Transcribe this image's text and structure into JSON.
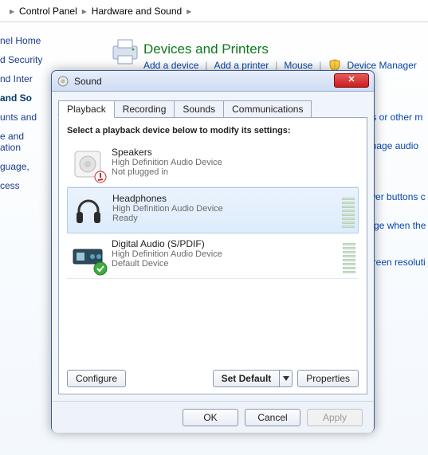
{
  "breadcrumb": {
    "a": "Control Panel",
    "b": "Hardware and Sound"
  },
  "leftnav": {
    "home": "nel Home",
    "i1": "d Security",
    "i2": "nd Inter",
    "i3": "and So",
    "i4": "unts and",
    "i5": "e and\nation",
    "i6": "guage,",
    "i7": "cess"
  },
  "header": {
    "title": "Devices and Printers",
    "links": {
      "add_device": "Add a device",
      "add_printer": "Add a printer",
      "mouse": "Mouse",
      "devmgr": "Device Manager"
    }
  },
  "sidelinks": {
    "a": "CDs or other m",
    "b": "Manage audio",
    "c": "power buttons c",
    "d": "hange when the",
    "e": "t screen resoluti"
  },
  "dialog": {
    "title": "Sound",
    "tabs": {
      "playback": "Playback",
      "recording": "Recording",
      "sounds": "Sounds",
      "comm": "Communications"
    },
    "instruction": "Select a playback device below to modify its settings:",
    "devices": [
      {
        "name": "Speakers",
        "desc": "High Definition Audio Device",
        "status": "Not plugged in"
      },
      {
        "name": "Headphones",
        "desc": "High Definition Audio Device",
        "status": "Ready"
      },
      {
        "name": "Digital Audio (S/PDIF)",
        "desc": "High Definition Audio Device",
        "status": "Default Device"
      }
    ],
    "buttons": {
      "configure": "Configure",
      "set_default": "Set Default",
      "properties": "Properties",
      "ok": "OK",
      "cancel": "Cancel",
      "apply": "Apply"
    }
  }
}
